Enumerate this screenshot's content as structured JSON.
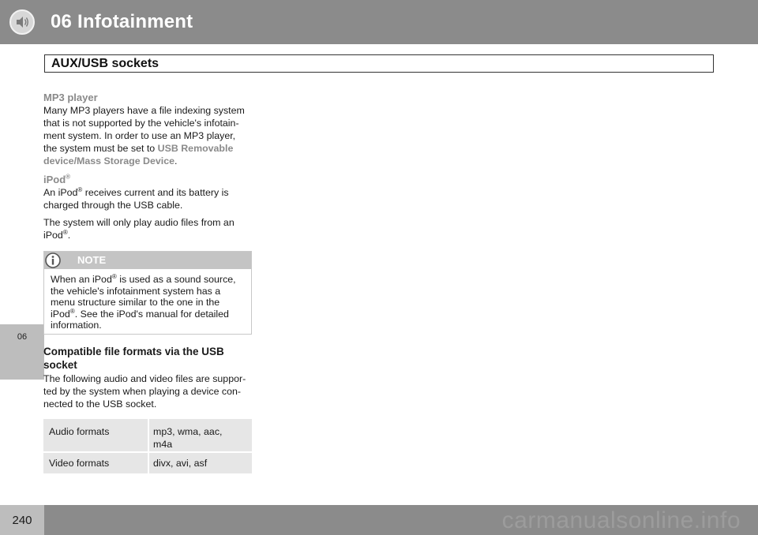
{
  "header": {
    "chapter_title": "06  Infotainment",
    "icon": "speaker-icon"
  },
  "section": {
    "title": "AUX/USB sockets"
  },
  "side_tab": {
    "label": "06"
  },
  "mp3": {
    "heading": "MP3 player",
    "line1": "Many MP3 players have a file indexing system",
    "line2": "that is not supported by the vehicle's infotain-",
    "line3": "ment system. In order to use an MP3 player,",
    "line4_pre": "the system must be set to ",
    "line4_link": "USB Removable",
    "line5_link": "device/Mass Storage Device",
    "line5_post": "."
  },
  "ipod": {
    "heading": "iPod",
    "reg": "®",
    "p1_a": "An iPod",
    "p1_b": " receives current and its battery is",
    "p1_c": "charged through the USB cable.",
    "p2_a": "The system will only play audio files from an",
    "p2_b": "iPod",
    "p2_c": "."
  },
  "note": {
    "label": "NOTE",
    "icon": "info-icon",
    "l1_a": "When an iPod",
    "l1_b": " is used as a sound source,",
    "l2": "the vehicle's infotainment system has a",
    "l3": "menu structure similar to the one in the",
    "l4_a": "iPod",
    "l4_b": ". See the iPod's manual for detailed",
    "l5": "information."
  },
  "formats": {
    "heading_l1": "Compatible file formats via the USB",
    "heading_l2": "socket",
    "p_l1": "The following audio and video files are suppor-",
    "p_l2": "ted by the system when playing a device con-",
    "p_l3": "nected to the USB socket.",
    "rows": [
      {
        "label": "Audio formats",
        "value_l1": "mp3, wma, aac,",
        "value_l2": "m4a"
      },
      {
        "label": "Video formats",
        "value_l1": "divx, avi, asf",
        "value_l2": ""
      }
    ]
  },
  "footer": {
    "page_number": "240",
    "watermark": "carmanualsonline.info"
  },
  "colors": {
    "header_gray": "#8b8b8b",
    "tab_gray": "#bdbdbd",
    "accent_gray_text": "#8a8a8a",
    "table_cell": "#e6e6e6"
  }
}
